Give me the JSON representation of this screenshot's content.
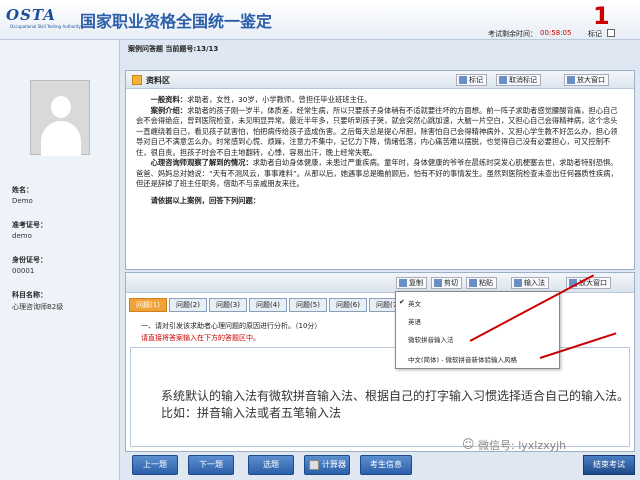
{
  "header": {
    "logo": "OSTA",
    "logo_sub": "Occupational Skill Testing Authority",
    "title": "国家职业资格全国统一鉴定",
    "big_number": "1",
    "timer_label": "考试剩余时间：",
    "timer_value": "00:58:05",
    "mark_label": "标记"
  },
  "sidebar": {
    "name_label": "姓名：",
    "name_value": "Demo",
    "ticket_label": "准考证号：",
    "ticket_value": "demo",
    "id_label": "身份证号：",
    "id_value": "00001",
    "subject_label": "科目名称：",
    "subject_value": "心理咨询师B2级"
  },
  "question_bar": {
    "text": "案例问答题  当前题号:13/13"
  },
  "material": {
    "title": "资料区",
    "btn_mark": "标记",
    "btn_unmark": "取消标记",
    "btn_enlarge": "放大窗口",
    "p1_label": "一般资料：",
    "p1": "求助者，女性，30岁，小学教师，曾担任毕业班班主任。",
    "p2_label": "案例介绍：",
    "p2": "求助者的孩子刚一岁半，体质差，经常生病，所以只要孩子身体稍有不适就要往坏的方面想。前一阵子求助者感觉腰酸背痛，担心自己会不会得绝症，曾到医院检查，未见明显异常。最近半年多，只要听到孩子哭，就会突然心跳加速，大脑一片空白，又担心自己会得精神病，这个念头一直缠绕着自己，看见孩子就害怕，怕把病传给孩子造成伤害。之后每天总是提心吊胆，除害怕自己会得精神病外，又担心学生教不好怎么办，担心领导对自己不满意怎么办。时常感到心慌、烦躁，注意力不集中，记忆力下降，情绪低落，内心痛苦难以摆脱，也觉得自己没有必要担心，可又控制不住，很自责。担孩子时会不自主地翻转，心悸，容易出汗，晚上经常失眠。",
    "p3_label": "心理咨询师观察了解到的情况：",
    "p3": "求助者自幼身体健康，未患过严重疾病。童年时，身体健康的爷爷在晨练时突发心肌梗塞去世，求助者特别恐惧。爸爸、妈妈总对她说：“天有不测风云，事事难料”。从那以后，她遇事总是瞻前顾后，怕有不好的事情发生。虽然到医院检查未查出任何器质性疾病，但还是辞掉了班主任职务，借助不与亲戚朋友来往。",
    "prompt": "请依据以上案例，回答下列问题："
  },
  "answer_toolbar": {
    "copy": "复制",
    "cut": "剪切",
    "paste": "粘贴",
    "ime": "输入法",
    "enlarge": "放大窗口"
  },
  "tabs": [
    "问题(1)",
    "问题(2)",
    "问题(3)",
    "问题(4)",
    "问题(5)",
    "问题(6)",
    "问题(7)"
  ],
  "question": {
    "text": "一、请对引发该求助者心理问题的原因进行分析。（10分）",
    "warning": "请直接将答案输入在下方的答题区中。"
  },
  "ime_menu": {
    "item1": "英文",
    "item2": "英语",
    "item3": "微软拼音输入法",
    "item4": "中文(简体) - 微软拼音新体验输入风格"
  },
  "answer_note": "系统默认的输入法有微软拼音输入法、根据自己的打字输入习惯选择适合自己的输入法。比如：拼音输入法或者五笔输入法",
  "bottom": {
    "prev": "上一题",
    "next": "下一题",
    "select": "选题",
    "calc": "计算器",
    "info": "考生信息",
    "submit": "结束考试"
  },
  "watermark": "微信号: lyxlzxyjh",
  "colors": {
    "accent": "#2c5fa8",
    "warning": "#cc0000",
    "tab_active": "#f0a23a"
  }
}
